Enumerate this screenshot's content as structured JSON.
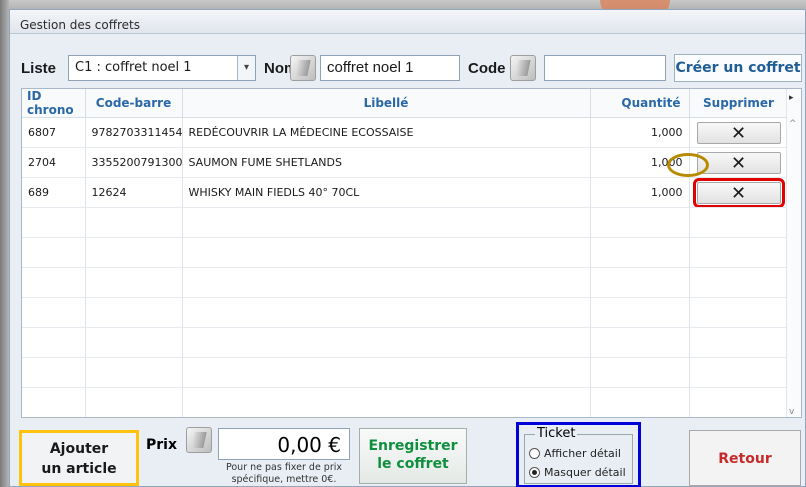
{
  "window": {
    "title": "Gestion des coffrets"
  },
  "toolbar": {
    "liste_label": "Liste",
    "liste_value": "C1 : coffret noel 1",
    "nom_label": "Nom",
    "nom_value": "coffret noel 1",
    "code_label": "Code",
    "code_value": "",
    "create_label": "Créer un coffret"
  },
  "table": {
    "columns": [
      "ID chrono",
      "Code-barre",
      "Libellé",
      "Quantité",
      "Supprimer"
    ],
    "rows": [
      {
        "id": "6807",
        "barcode": "9782703311454",
        "label": "REDÉCOUVRIR LA MÉDECINE ECOSSAISE",
        "qty": "1,000",
        "delete": "✕"
      },
      {
        "id": "2704",
        "barcode": "3355200791300",
        "label": "SAUMON FUME SHETLANDS",
        "qty": "1,000",
        "delete": "✕"
      },
      {
        "id": "689",
        "barcode": "12624",
        "label": "WHISKY MAIN FIEDLS 40° 70CL",
        "qty": "1,000",
        "delete": "✕"
      }
    ]
  },
  "bottom": {
    "add_line1": "Ajouter",
    "add_line2": "un article",
    "prix_label": "Prix",
    "prix_value": "0,00 €",
    "prix_note_1": "Pour ne pas fixer de prix",
    "prix_note_2": "spécifique, mettre 0€.",
    "save_line1": "Enregistrer",
    "save_line2": "le coffret",
    "ticket_title": "Ticket",
    "radio_show": "Afficher détail",
    "radio_hide": "Masquer détail",
    "back_label": "Retour"
  },
  "colors": {
    "highlight_red": "#e10000",
    "highlight_gold": "#b88a00",
    "highlight_blue": "#0000d9",
    "highlight_yellow": "#ffc20e"
  }
}
